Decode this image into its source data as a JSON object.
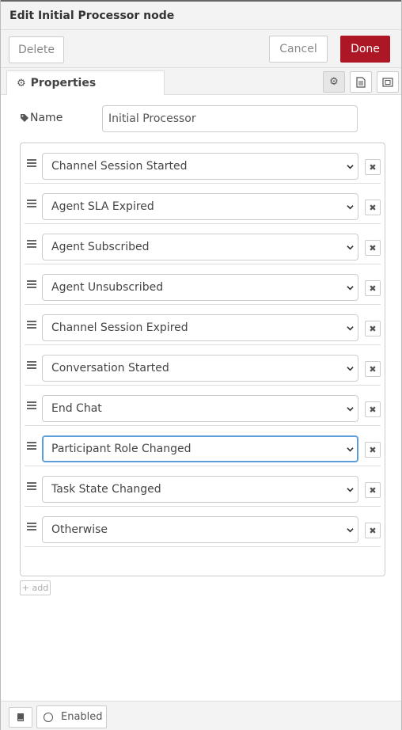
{
  "tray": {
    "title": "Edit Initial Processor node"
  },
  "toolbar": {
    "delete_label": "Delete",
    "cancel_label": "Cancel",
    "done_label": "Done"
  },
  "tabs": {
    "properties_label": "Properties",
    "icons": [
      "gear-icon",
      "description-icon",
      "appearance-icon"
    ]
  },
  "form": {
    "name_label": "Name",
    "name_value": "Initial Processor"
  },
  "rules": [
    {
      "value": "Channel Session Started"
    },
    {
      "value": "Agent SLA Expired"
    },
    {
      "value": "Agent Subscribed"
    },
    {
      "value": "Agent Unsubscribed"
    },
    {
      "value": "Channel Session Expired"
    },
    {
      "value": "Conversation Started"
    },
    {
      "value": "End Chat"
    },
    {
      "value": "Participant Role Changed",
      "focused": true
    },
    {
      "value": "Task State Changed"
    },
    {
      "value": "Otherwise"
    }
  ],
  "add_label": "add",
  "footer": {
    "enabled_label": "Enabled"
  },
  "colors": {
    "done": "#ad1625",
    "focus": "#5b9dd9"
  }
}
